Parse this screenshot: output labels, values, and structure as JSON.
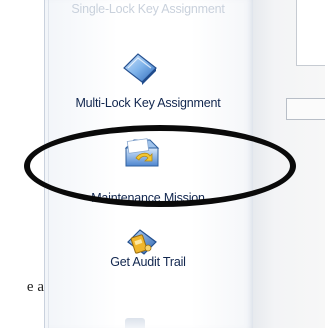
{
  "sidebar": {
    "items": [
      {
        "label": "Single-Lock Key Assignment",
        "icon": "key-assignment-icon",
        "faded": true
      },
      {
        "label": "Multi-Lock Key Assignment",
        "icon": "multi-lock-key-icon"
      },
      {
        "label": "Maintenance Mission",
        "icon": "maintenance-mission-icon",
        "highlighted": true
      },
      {
        "label": "Get Audit Trail",
        "icon": "audit-trail-icon"
      }
    ]
  },
  "annotation": {
    "stray_text": "e a"
  },
  "colors": {
    "label": "#12274f",
    "faded_label": "#c9d1dc",
    "highlight_ring": "#0a0a0a",
    "sidebar_border": "#b9c3d1"
  }
}
